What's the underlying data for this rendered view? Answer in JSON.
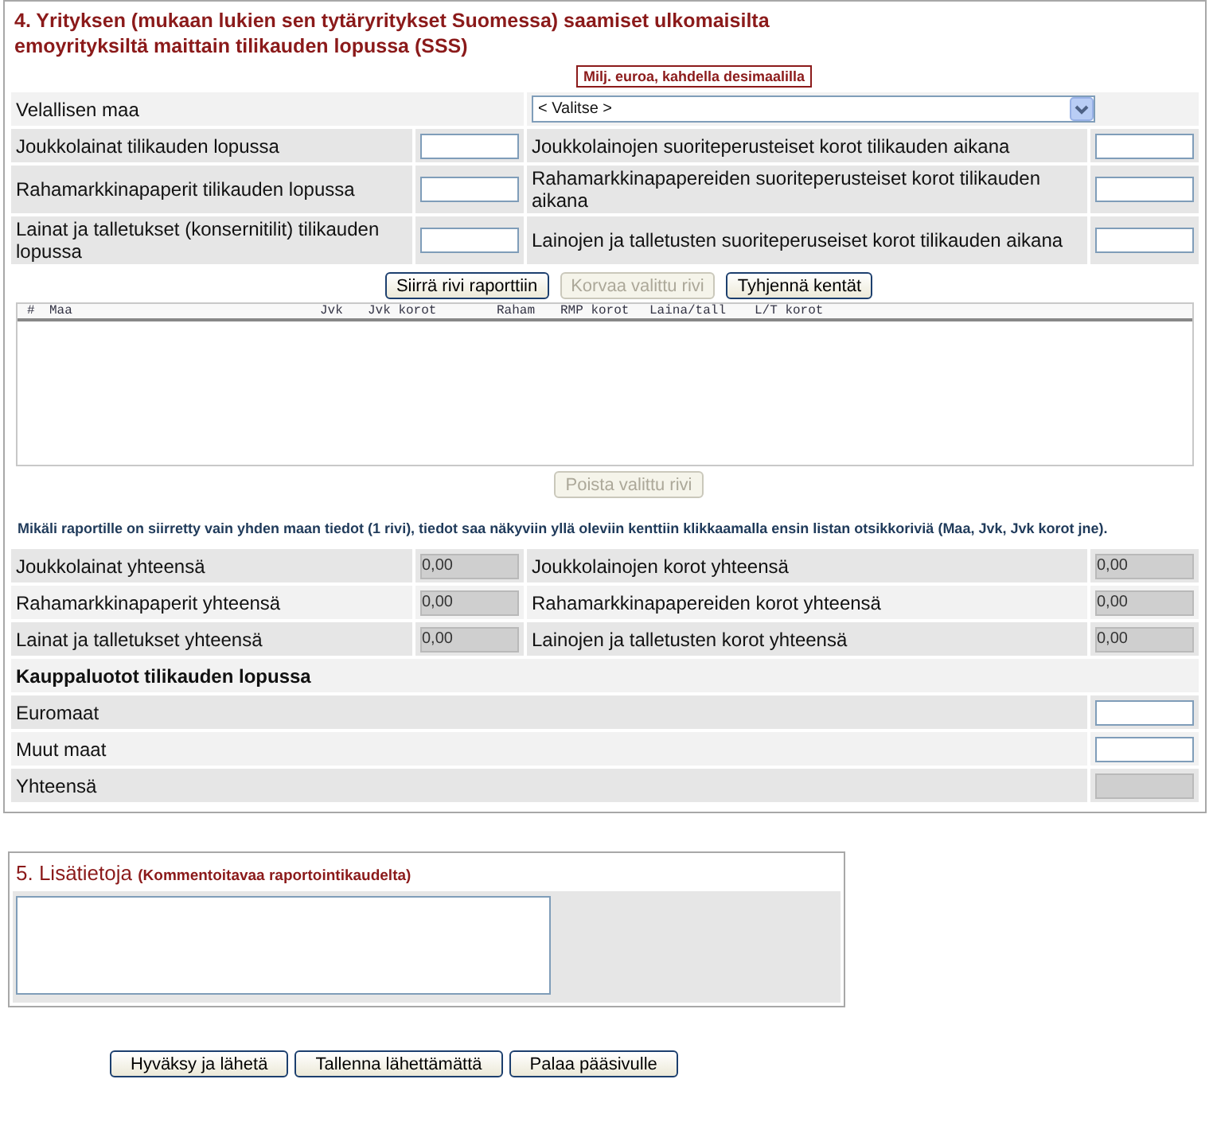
{
  "section4": {
    "title": "4. Yrityksen (mukaan lukien sen tytäryritykset Suomessa) saamiset ulkomaisilta emoyrityksiltä maittain tilikauden lopussa (SSS)",
    "unit_note": "Milj. euroa, kahdella desimaalilla",
    "country_select": {
      "label": "Velallisen maa",
      "value": "< Valitse >"
    },
    "input_rows": [
      {
        "left_label": "Joukkolainat tilikauden lopussa",
        "right_label": "Joukkolainojen suoriteperusteiset korot tilikauden aikana"
      },
      {
        "left_label": "Rahamarkkinapaperit tilikauden lopussa",
        "right_label": "Rahamarkkinapapereiden suoriteperusteiset korot tilikauden aikana"
      },
      {
        "left_label": "Lainat ja talletukset (konsernitilit) tilikauden lopussa",
        "right_label": "Lainojen ja talletusten suoriteperuseiset korot tilikauden aikana"
      }
    ],
    "actions": [
      {
        "label": "Siirrä rivi raporttiin",
        "disabled": false
      },
      {
        "label": "Korvaa valittu rivi",
        "disabled": true
      },
      {
        "label": "Tyhjennä kentät",
        "disabled": false
      }
    ],
    "list": {
      "columns": [
        "#",
        "Maa",
        "Jvk",
        "Jvk korot",
        "Raham",
        "RMP korot",
        "Laina/tall",
        "L/T korot"
      ]
    },
    "remove_button": {
      "label": "Poista valittu rivi",
      "disabled": true
    },
    "note": "Mikäli raportille on siirretty vain yhden maan tiedot (1 rivi), tiedot saa näkyviin yllä oleviin kenttiin klikkaamalla ensin listan otsikkoriviä (Maa, Jvk, Jvk korot jne).",
    "totals": [
      {
        "left_label": "Joukkolainat yhteensä",
        "left_value": "0,00",
        "right_label": "Joukkolainojen korot yhteensä",
        "right_value": "0,00"
      },
      {
        "left_label": "Rahamarkkinapaperit yhteensä",
        "left_value": "0,00",
        "right_label": "Rahamarkkinapapereiden korot yhteensä",
        "right_value": "0,00"
      },
      {
        "left_label": "Lainat ja talletukset yhteensä",
        "left_value": "0,00",
        "right_label": "Lainojen ja talletusten korot yhteensä",
        "right_value": "0,00"
      }
    ],
    "trade_credit": {
      "heading": "Kauppaluotot tilikauden lopussa",
      "rows": [
        {
          "label": "Euromaat",
          "kind": "input"
        },
        {
          "label": "Muut maat",
          "kind": "input"
        },
        {
          "label": "Yhteensä",
          "kind": "total"
        }
      ]
    }
  },
  "section5": {
    "title": "5. Lisätietoja",
    "subtitle": "(Kommentoitavaa raportointikaudelta)"
  },
  "buttons": [
    {
      "label": "Hyväksy ja lähetä",
      "disabled": false
    },
    {
      "label": "Tallenna lähettämättä",
      "disabled": false
    },
    {
      "label": "Palaa pääsivulle",
      "disabled": false
    }
  ]
}
